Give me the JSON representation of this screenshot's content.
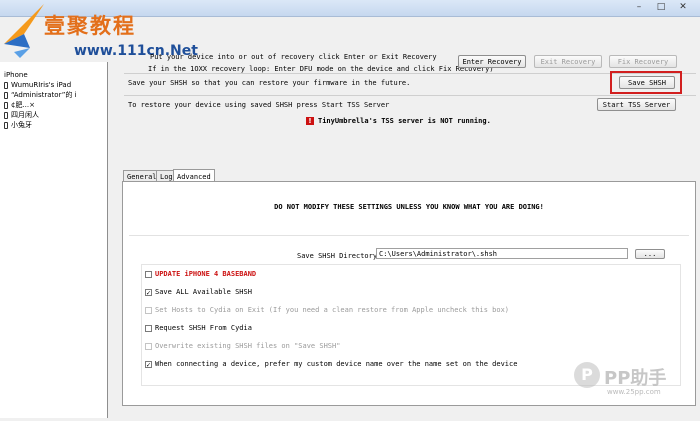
{
  "watermark": {
    "brand": "壹聚教程",
    "url": "www.111cn.Net"
  },
  "pp_watermark": {
    "brand": "PP助手",
    "url": "www.25pp.com"
  },
  "sidebar": {
    "items": [
      {
        "label": "iPhone"
      },
      {
        "label": "WumuRIris's iPad"
      },
      {
        "label": "“Administrator”的 i"
      },
      {
        "label": "¢肥...×"
      },
      {
        "label": "四月闲人"
      },
      {
        "label": "小兔牙"
      }
    ]
  },
  "header": {
    "recovery_text": "Put your device into or out of recovery click Enter or Exit Recovery",
    "loop_text": "If in the 1OXX recovery loop: Enter DFU mode on the device and click Fix Recovery)",
    "enter_recovery": "Enter Recovery",
    "exit_recovery": "Exit Recovery",
    "fix_recovery": "Fix Recovery",
    "save_text": "Save your SHSH so that you can restore your firmware in the future.",
    "save_shsh": "Save SHSH",
    "restore_text": "To restore your device using saved SHSH press Start TSS Server",
    "start_tss": "Start TSS Server",
    "status_text": "TinyUmbrella's TSS server is NOT running."
  },
  "tabs": [
    {
      "label": "General"
    },
    {
      "label": "Log"
    },
    {
      "label": "Advanced"
    }
  ],
  "advanced": {
    "warning": "DO NOT MODIFY THESE SETTINGS UNLESS YOU KNOW WHAT YOU ARE DOING!",
    "dir_label": "Save SHSH Directory:",
    "dir_value": "C:\\Users\\Administrator\\.shsh",
    "browse": "...",
    "options": [
      {
        "label": "UPDATE iPHONE 4 BASEBAND",
        "checked": false,
        "disabled": false,
        "red": true
      },
      {
        "label": "Save ALL Available SHSH",
        "checked": true,
        "disabled": false,
        "red": false
      },
      {
        "label": "Set Hosts to Cydia on Exit (If you need a clean restore from Apple uncheck this box)",
        "checked": false,
        "disabled": true,
        "red": false
      },
      {
        "label": "Request SHSH From Cydia",
        "checked": false,
        "disabled": false,
        "red": false
      },
      {
        "label": "Overwrite existing SHSH files on \"Save SHSH\"",
        "checked": false,
        "disabled": true,
        "red": false
      },
      {
        "label": "When connecting a device, prefer my custom device name over the name set on the device",
        "checked": true,
        "disabled": false,
        "red": false
      }
    ]
  },
  "colors": {
    "accent_red": "#d21f1f",
    "status_red": "#cc1111"
  }
}
